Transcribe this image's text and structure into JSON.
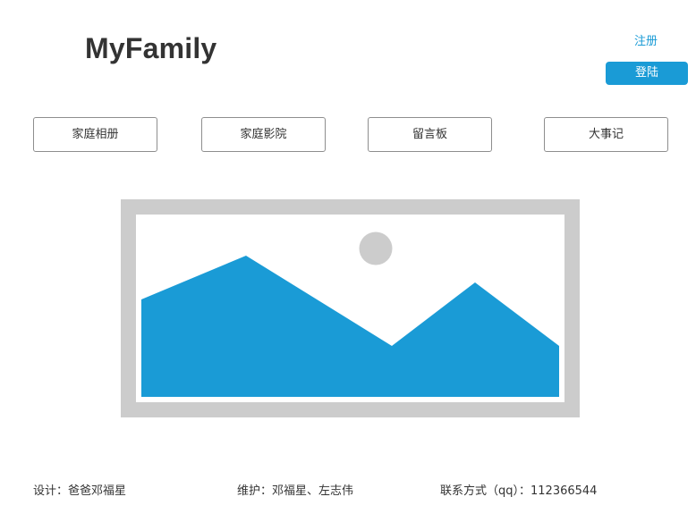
{
  "header": {
    "site_title": "MyFamily",
    "register_label": "注册",
    "login_label": "登陆"
  },
  "nav": {
    "items": [
      {
        "label": "家庭相册"
      },
      {
        "label": "家庭影院"
      },
      {
        "label": "留言板"
      },
      {
        "label": "大事记"
      }
    ]
  },
  "hero": {
    "icon": "image-placeholder-icon"
  },
  "footer": {
    "design": "设计：爸爸邓福星",
    "maintain": "维护：邓福星、左志伟",
    "contact": "联系方式（qq）：112366544"
  },
  "colors": {
    "accent": "#1a9bd6",
    "frame": "#cccccc",
    "text": "#333333",
    "button_border": "#8e8e8e"
  }
}
